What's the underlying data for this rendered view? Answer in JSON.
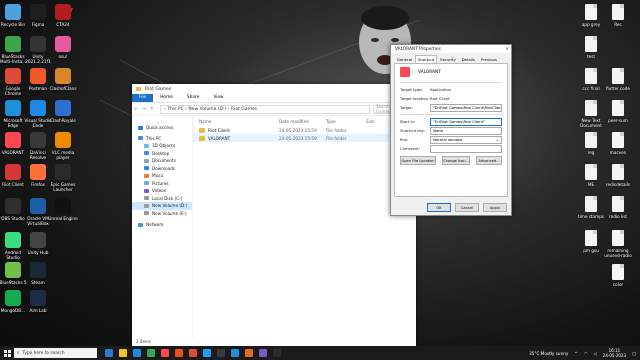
{
  "desktop_icons": [
    {
      "label": "Recycle Bin",
      "icon": "recycle-bin-icon",
      "color": "#4aa3df"
    },
    {
      "label": "Figma",
      "icon": "figma-icon",
      "color": "#1e1e1e"
    },
    {
      "label": "CTA24",
      "icon": "cta24-icon",
      "color": "#b01e1e"
    },
    {
      "label": "BlueStacks Multi-Insta...",
      "icon": "bluestacks-multi-icon",
      "color": "#3ba64a"
    },
    {
      "label": "Unity 2021.2.21f1",
      "icon": "unity-icon",
      "color": "#333333"
    },
    {
      "label": "osu!",
      "icon": "osu-icon",
      "color": "#e85a9c"
    },
    {
      "label": "Google Chrome",
      "icon": "chrome-icon",
      "color": "#dd4b39"
    },
    {
      "label": "Postman",
      "icon": "postman-icon",
      "color": "#ef5b25"
    },
    {
      "label": "ClashofClans",
      "icon": "clash-of-clans-icon",
      "color": "#d8862a"
    },
    {
      "label": "Microsoft Edge",
      "icon": "edge-icon",
      "color": "#1f8fd8"
    },
    {
      "label": "Visual Studio Code",
      "icon": "vscode-icon",
      "color": "#1e88e5"
    },
    {
      "label": "ClashRoyale",
      "icon": "clash-royale-icon",
      "color": "#2f6fd0"
    },
    {
      "label": "VALORANT",
      "icon": "valorant-icon",
      "color": "#ff4655"
    },
    {
      "label": "DaVinci Resolve",
      "icon": "davinci-icon",
      "color": "#3a3a3a"
    },
    {
      "label": "VLC media player",
      "icon": "vlc-icon",
      "color": "#f08a00"
    },
    {
      "label": "Riot Client",
      "icon": "riot-client-icon",
      "color": "#d13639"
    },
    {
      "label": "Firefox",
      "icon": "firefox-icon",
      "color": "#ff7139"
    },
    {
      "label": "Epic Games Launcher",
      "icon": "epic-games-icon",
      "color": "#2a2a2a"
    },
    {
      "label": "OBS Studio",
      "icon": "obs-icon",
      "color": "#302e31"
    },
    {
      "label": "Oracle VM VirtualBox",
      "icon": "virtualbox-icon",
      "color": "#1c5fa6"
    },
    {
      "label": "Unreal Engine",
      "icon": "unreal-icon",
      "color": "#111111"
    },
    {
      "label": "Android Studio",
      "icon": "android-studio-icon",
      "color": "#3ddc84"
    },
    {
      "label": "Unity Hub",
      "icon": "unity-hub-icon",
      "color": "#444444"
    },
    {
      "label": "BlueStacks 5",
      "icon": "bluestacks-icon",
      "color": "#6fbf4a"
    },
    {
      "label": "Steam",
      "icon": "steam-icon",
      "color": "#1b2838"
    },
    {
      "label": "MongoDB...",
      "icon": "mongodb-icon",
      "color": "#13aa52"
    },
    {
      "label": "Aim Lab",
      "icon": "aim-lab-icon",
      "color": "#1f2a44"
    }
  ],
  "right_icons": [
    {
      "label": "app grey"
    },
    {
      "label": "Rec"
    },
    {
      "label": "test"
    },
    {
      "label": "ccc final"
    },
    {
      "label": "flutter.code"
    },
    {
      "label": "New Text Document"
    },
    {
      "label": "peer-sum"
    },
    {
      "label": "reg"
    },
    {
      "label": "macven"
    },
    {
      "label": "ME"
    },
    {
      "label": "redisdetails"
    },
    {
      "label": "time stamps"
    },
    {
      "label": "radio list"
    },
    {
      "label": "pm gsu"
    },
    {
      "label": "remaining unused-radio"
    },
    {
      "label": "color"
    }
  ],
  "explorer": {
    "window_title": "Riot Games",
    "ribbon_tabs": [
      "File",
      "Home",
      "Share",
      "View"
    ],
    "address_path": "›  This PC  ›  New Volume (D:)  ›  Riot Games",
    "search_placeholder": "Search Riot Games",
    "columns": {
      "name": "Name",
      "date": "Date modified",
      "type": "Type",
      "size": "Size"
    },
    "nav_items": [
      {
        "label": "Quick access",
        "sub": false,
        "selected": false,
        "color": "#2f7bd9"
      },
      {
        "label": "This PC",
        "sub": false,
        "selected": false,
        "color": "#4a90d9"
      },
      {
        "label": "3D Objects",
        "sub": true,
        "selected": false,
        "color": "#6bb5e8"
      },
      {
        "label": "Desktop",
        "sub": true,
        "selected": false,
        "color": "#3a8ee6"
      },
      {
        "label": "Documents",
        "sub": true,
        "selected": false,
        "color": "#8aa4c0"
      },
      {
        "label": "Downloads",
        "sub": true,
        "selected": false,
        "color": "#2b8be0"
      },
      {
        "label": "Music",
        "sub": true,
        "selected": false,
        "color": "#e0803a"
      },
      {
        "label": "Pictures",
        "sub": true,
        "selected": false,
        "color": "#6ab0e0"
      },
      {
        "label": "Videos",
        "sub": true,
        "selected": false,
        "color": "#7a5ac8"
      },
      {
        "label": "Local Disk (C:)",
        "sub": true,
        "selected": false,
        "color": "#9a9a9a"
      },
      {
        "label": "New Volume (D:)",
        "sub": true,
        "selected": true,
        "color": "#9a9a9a"
      },
      {
        "label": "New Volume (E:)",
        "sub": true,
        "selected": false,
        "color": "#9a9a9a"
      },
      {
        "label": "Network",
        "sub": false,
        "selected": false,
        "color": "#4a90d9"
      }
    ],
    "rows": [
      {
        "name": "Riot Client",
        "date": "24-05-2023 15:59",
        "type": "File folder",
        "size": ""
      },
      {
        "name": "VALORANT",
        "date": "24-05-2023 15:59",
        "type": "File folder",
        "size": ""
      }
    ],
    "status": "2 items"
  },
  "properties": {
    "title": "VALORANT Properties",
    "close": "×",
    "tabs": [
      "General",
      "Shortcut",
      "Security",
      "Details",
      "Previous Versions"
    ],
    "active_tab": "Shortcut",
    "name": "VALORANT",
    "fields": {
      "target_type_label": "Target type:",
      "target_type": "Application",
      "target_location_label": "Target location:",
      "target_location": "Riot Client",
      "target_label": "Target:",
      "target": "\"D:\\Riot Games\\Riot Client\\RiotClientServices.ex",
      "start_in_label": "Start in:",
      "start_in": "\"D:\\Riot Games\\Riot Client\"",
      "shortcut_key_label": "Shortcut key:",
      "shortcut_key": "None",
      "run_label": "Run:",
      "run": "Normal window",
      "comment_label": "Comment:",
      "comment": ""
    },
    "buttons": {
      "open_location": "Open File Location",
      "change_icon": "Change Icon...",
      "advanced": "Advanced..."
    },
    "footer": {
      "ok": "OK",
      "cancel": "Cancel",
      "apply": "Apply"
    }
  },
  "taskbar": {
    "search_placeholder": "Type here to search",
    "weather": "35°C  Mostly sunny",
    "time": "16:11",
    "date": "24-05-2023",
    "apps": [
      "#2b7cd3",
      "#f5c518",
      "#1e88e5",
      "#34a853",
      "#ff4655",
      "#e94e1b",
      "#dd4b39",
      "#1a9fff",
      "#3a3a3a",
      "#1f8fd8",
      "#e06b1e",
      "#7a5ac8",
      "#2c2c2c"
    ]
  },
  "banner": {
    "text": "CR7"
  }
}
